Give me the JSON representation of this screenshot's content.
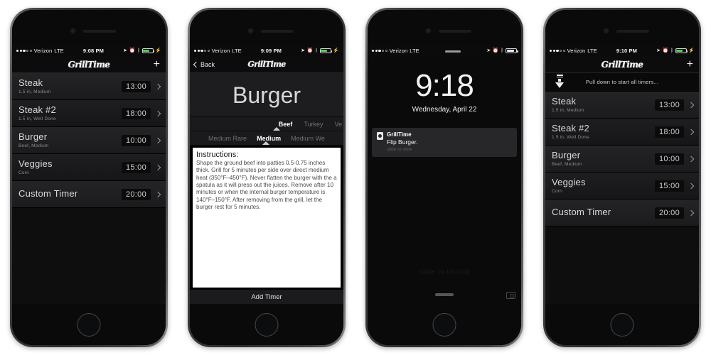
{
  "app": {
    "name": "GrillTime",
    "carrier": "Verizon",
    "network": "LTE"
  },
  "phones": [
    {
      "id": "timer-list",
      "status_time": "9:08 PM",
      "nav": {
        "title": "GrillTime",
        "add_label": "+"
      }
    },
    {
      "id": "timer-detail",
      "status_time": "9:09 PM",
      "nav": {
        "title": "GrillTime",
        "back_label": "Back"
      },
      "hero_title": "Burger",
      "meat_options": [
        "Beef",
        "Turkey",
        "Ve"
      ],
      "meat_selected": "Beef",
      "doneness_options": [
        "Medium Rare",
        "Medium",
        "Medium We"
      ],
      "doneness_selected": "Medium",
      "instructions_heading": "Instructions:",
      "instructions_body": "Shape the ground beef into patties 0.5-0.75 inches thick. Grill for 5 minutes per side over direct medium heat (350°F–450°F). Never flatten the burger with the a spatula as it will press out the juices. Remove after 10 minutes or when the internal burger temperature is 140°F–150°F. After removing from the grill, let the burger rest for 5 minutes.",
      "add_timer_label": "Add Timer"
    },
    {
      "id": "lock-screen",
      "status_time": "",
      "clock": "9:18",
      "date": "Wednesday, April 22",
      "notification": {
        "app": "GrillTime",
        "message": "Flip Burger.",
        "slide_hint": "slide to view"
      },
      "slide_to_unlock": "slide to unlock"
    },
    {
      "id": "timer-list-pull",
      "status_time": "9:10 PM",
      "nav": {
        "title": "GrillTime",
        "add_label": "+"
      },
      "pull_label": "Pull down to start all timers..."
    }
  ],
  "timers": [
    {
      "title": "Steak",
      "subtitle": "1.5 in, Medium",
      "time": "13:00"
    },
    {
      "title": "Steak #2",
      "subtitle": "1.5 in, Well Done",
      "time": "18:00"
    },
    {
      "title": "Burger",
      "subtitle": "Beef, Medium",
      "time": "10:00"
    },
    {
      "title": "Veggies",
      "subtitle": "Corn",
      "time": "15:00"
    },
    {
      "title": "Custom Timer",
      "subtitle": "",
      "time": "20:00"
    }
  ],
  "colors": {
    "battery_green": "#47d34a",
    "screen_black": "#0a0a0b",
    "row_text": "#d9d9d9"
  }
}
